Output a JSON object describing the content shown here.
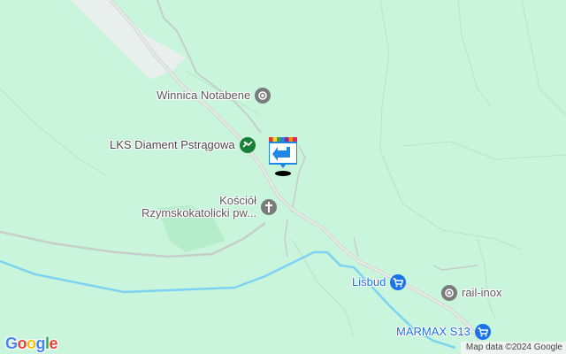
{
  "map": {
    "background": "#c9f5dc",
    "road_color": "#c6cec9",
    "river_color": "#7dd2f2"
  },
  "pois": [
    {
      "key": "winnica",
      "label": "Winnica Notabene",
      "icon": "dot-circle-icon",
      "category": "generic"
    },
    {
      "key": "lks",
      "label": "LKS Diament Pstrągowa",
      "icon": "sports-icon",
      "category": "sports"
    },
    {
      "key": "kosciol",
      "label_line1": "Kościół",
      "label_line2": "Rzymskokatolicki pw...",
      "icon": "cross-icon",
      "category": "church"
    },
    {
      "key": "lisbud",
      "label": "Lisbud",
      "icon": "shopping-cart-icon",
      "category": "shop"
    },
    {
      "key": "railinox",
      "label": "rail-inox",
      "icon": "dot-circle-icon",
      "category": "generic"
    },
    {
      "key": "marmax",
      "label": "MARMAX S13",
      "icon": "shopping-cart-icon",
      "category": "shop"
    }
  ],
  "marker": {
    "icon": "location-marker-icon",
    "colors": [
      "#e53935",
      "#fdd835",
      "#43a047",
      "#1e88e5",
      "#8e24aa",
      "#fb8c00",
      "#e91e63"
    ],
    "arrow_color": "#1e88e5"
  },
  "logo": {
    "letters": [
      {
        "ch": "G",
        "color": "#4285F4"
      },
      {
        "ch": "o",
        "color": "#EA4335"
      },
      {
        "ch": "o",
        "color": "#FBBC05"
      },
      {
        "ch": "g",
        "color": "#4285F4"
      },
      {
        "ch": "l",
        "color": "#34A853"
      },
      {
        "ch": "e",
        "color": "#EA4335"
      }
    ]
  },
  "attribution": "Map data ©2024 Google"
}
